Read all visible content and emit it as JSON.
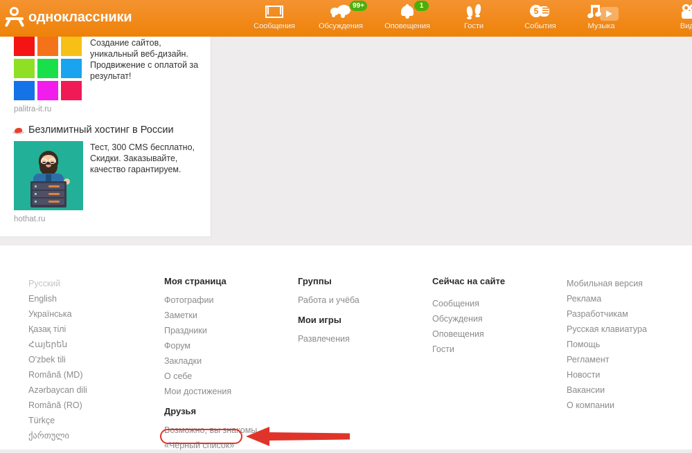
{
  "header": {
    "logo_text": "одноклассники",
    "nav": [
      {
        "label": "Сообщения",
        "icon": "envelope-icon",
        "badge": null
      },
      {
        "label": "Обсуждения",
        "icon": "speech-bubbles-icon",
        "badge": "99+"
      },
      {
        "label": "Оповещения",
        "icon": "bell-icon",
        "badge": "1"
      },
      {
        "label": "Гости",
        "icon": "footprints-icon",
        "badge": null
      },
      {
        "label": "События",
        "icon": "events-hand-icon",
        "badge": null,
        "icon_value": "5"
      },
      {
        "label": "Музыка",
        "icon": "music-note-icon",
        "badge": null
      },
      {
        "label": "Видео",
        "icon": "video-camera-icon",
        "badge": null
      }
    ],
    "colors": {
      "bar_top": "#f59331",
      "bar_bottom": "#ee8208",
      "badge": "#4caf07"
    }
  },
  "ads": [
    {
      "name": "palitra",
      "text": "Создание сайтов, уникальный веб-дизайн. Продвижение с оплатой за результат!",
      "url": "palitra-it.ru",
      "swatches": [
        "#f41414",
        "#f4731a",
        "#f7c018",
        "#8fe024",
        "#19e04a",
        "#1aa3ef",
        "#1473e6",
        "#f21ced",
        "#f01a55"
      ]
    },
    {
      "name": "hothat",
      "title": "Безлимитный хостинг в России",
      "text": "Тест, 300 CMS бесплатно, Скидки. Заказывайте, качество гарантируем.",
      "url": "hothat.ru",
      "image_bg": "#22b098"
    }
  ],
  "footer": {
    "languages": [
      "Русский",
      "English",
      "Українська",
      "Қазақ тілі",
      "Հայերեն",
      "O'zbek tili",
      "Română (MD)",
      "Azərbaycan dili",
      "Română (RO)",
      "Türkçe",
      "ქართული"
    ],
    "col_my_page": {
      "heading": "Моя страница",
      "links": [
        "Фотографии",
        "Заметки",
        "Праздники",
        "Форум",
        "Закладки",
        "О себе",
        "Мои достижения"
      ]
    },
    "col_friends": {
      "heading": "Друзья",
      "links": [
        "Возможно, вы знакомы",
        "«Чёрный список»"
      ]
    },
    "col_groups": {
      "heading": "Группы",
      "links": [
        "Работа и учёба"
      ]
    },
    "col_games": {
      "heading": "Мои игры",
      "links": [
        "Развлечения"
      ]
    },
    "col_online": {
      "heading": "Сейчас на сайте",
      "links": [
        "Сообщения",
        "Обсуждения",
        "Оповещения",
        "Гости"
      ]
    },
    "col_service": {
      "links": [
        "Мобильная версия",
        "Реклама",
        "Разработчикам",
        "Русская клавиатура",
        "Помощь",
        "Регламент",
        "Новости",
        "Вакансии",
        "О компании"
      ]
    }
  },
  "annotation": {
    "highlight_target": "«Чёрный список»",
    "color": "#e0342a"
  }
}
